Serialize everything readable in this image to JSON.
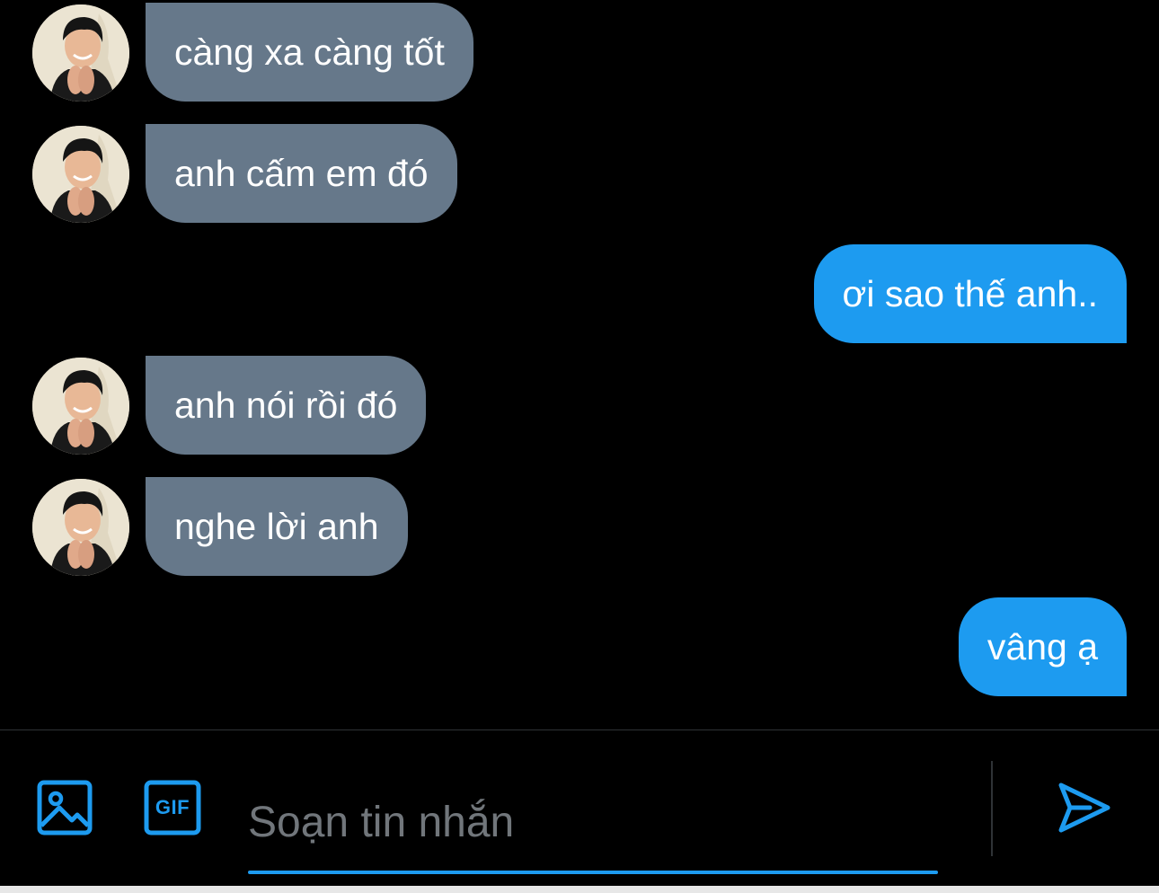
{
  "colors": {
    "background": "#000000",
    "incoming_bubble": "#66788a",
    "outgoing_bubble": "#1d9bf0",
    "accent": "#1d9bf0",
    "placeholder": "#71767b"
  },
  "messages": [
    {
      "direction": "incoming",
      "text": "càng xa càng tốt",
      "avatar": "avatar-photo"
    },
    {
      "direction": "incoming",
      "text": "anh cấm em đó",
      "avatar": "avatar-photo"
    },
    {
      "direction": "outgoing",
      "text": "ơi sao thế anh.."
    },
    {
      "direction": "incoming",
      "text": "anh nói rồi đó",
      "avatar": "avatar-photo"
    },
    {
      "direction": "incoming",
      "text": "nghe lời anh",
      "avatar": "avatar-photo"
    },
    {
      "direction": "outgoing",
      "text": "vâng ạ"
    }
  ],
  "composer": {
    "placeholder": "Soạn tin nhắn",
    "value": "",
    "image_icon": "image-icon",
    "gif_icon": "gif-icon",
    "gif_label": "GIF",
    "send_icon": "send-icon"
  }
}
